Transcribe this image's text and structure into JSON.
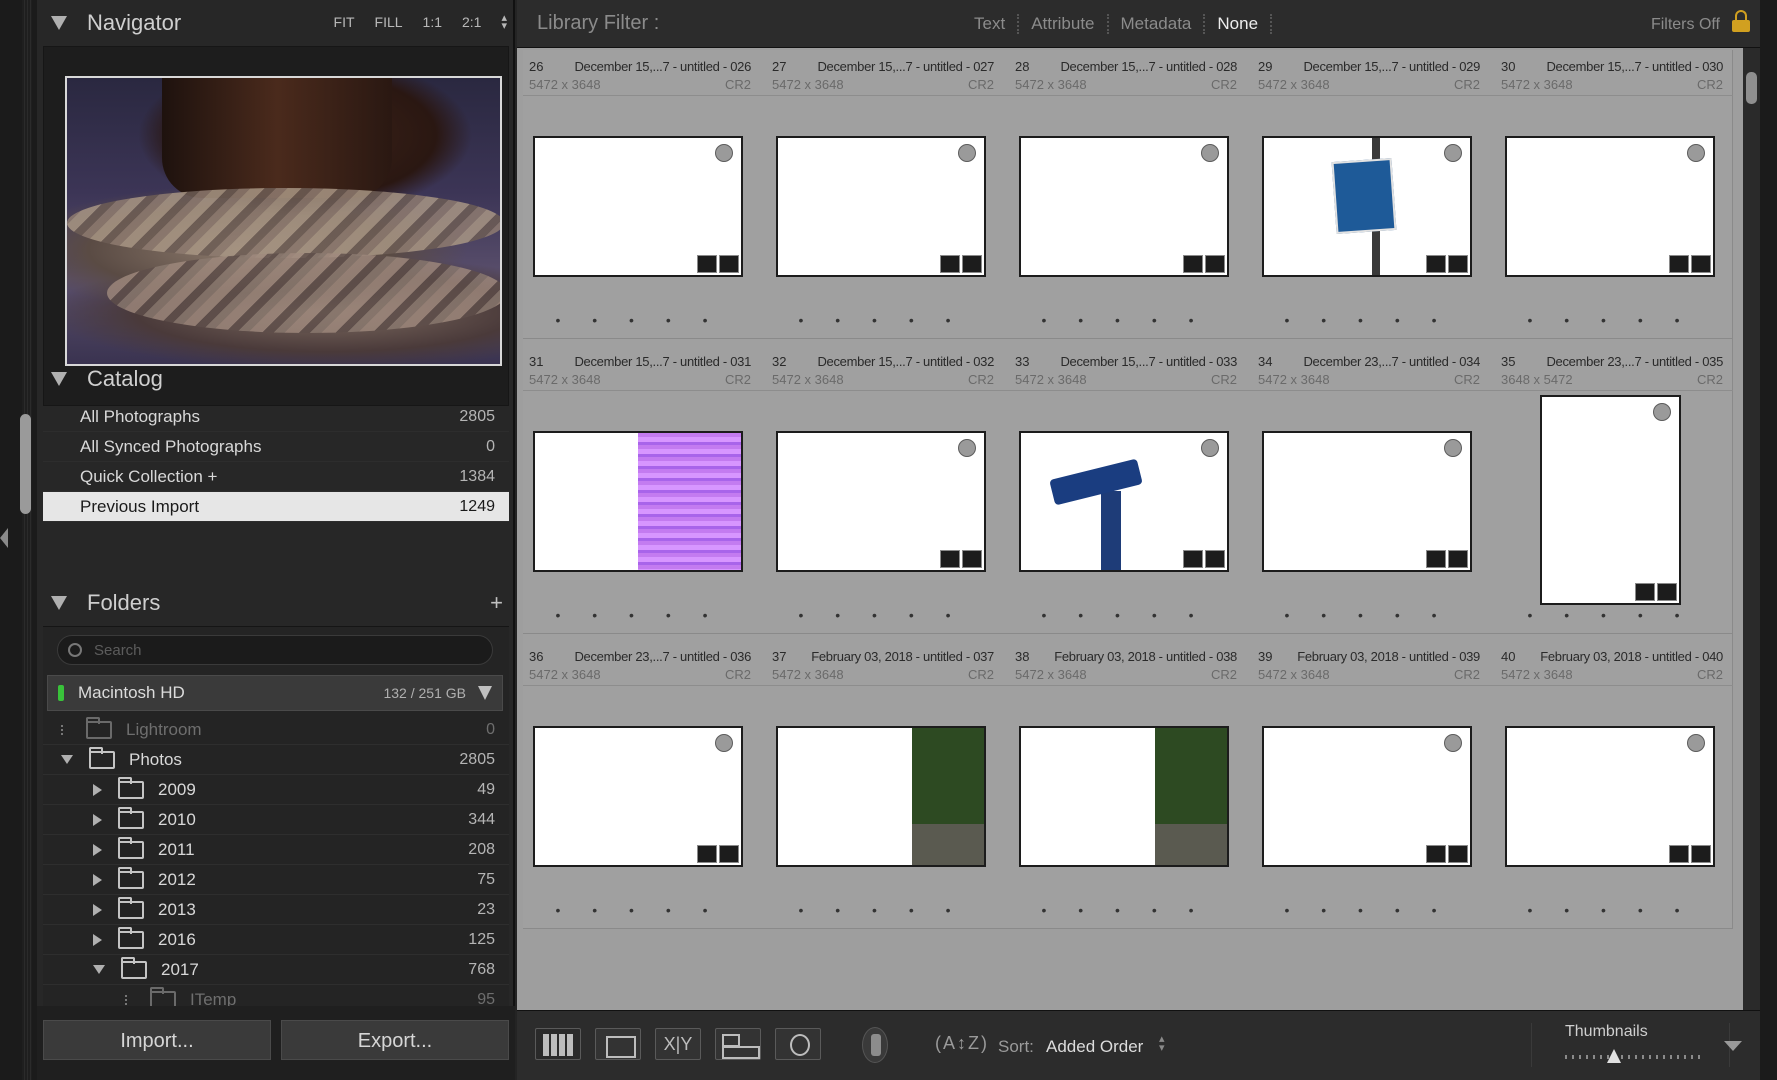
{
  "navigator": {
    "title": "Navigator",
    "zoom_options": [
      "FIT",
      "FILL",
      "1:1",
      "2:1"
    ]
  },
  "catalog": {
    "title": "Catalog",
    "items": [
      {
        "label": "All Photographs",
        "count": "2805"
      },
      {
        "label": "All Synced Photographs",
        "count": "0"
      },
      {
        "label": "Quick Collection +",
        "count": "1384"
      },
      {
        "label": "Previous Import",
        "count": "1249",
        "selected": true
      }
    ]
  },
  "folders": {
    "title": "Folders",
    "add_label": "+",
    "search_placeholder": "Search",
    "volume": {
      "name": "Macintosh HD",
      "usage": "132 / 251 GB"
    },
    "tree": [
      {
        "name": "Lightroom",
        "count": "0",
        "depth": 0,
        "expand": "none",
        "dim": true
      },
      {
        "name": "Photos",
        "count": "2805",
        "depth": 0,
        "expand": "down"
      },
      {
        "name": "2009",
        "count": "49",
        "depth": 1,
        "expand": "right"
      },
      {
        "name": "2010",
        "count": "344",
        "depth": 1,
        "expand": "right"
      },
      {
        "name": "2011",
        "count": "208",
        "depth": 1,
        "expand": "right"
      },
      {
        "name": "2012",
        "count": "75",
        "depth": 1,
        "expand": "right"
      },
      {
        "name": "2013",
        "count": "23",
        "depth": 1,
        "expand": "right"
      },
      {
        "name": "2016",
        "count": "125",
        "depth": 1,
        "expand": "right"
      },
      {
        "name": "2017",
        "count": "768",
        "depth": 1,
        "expand": "down"
      },
      {
        "name": "ITemp",
        "count": "95",
        "depth": 2,
        "expand": "none",
        "dim": true
      }
    ]
  },
  "actions": {
    "import_label": "Import...",
    "export_label": "Export..."
  },
  "library_filter": {
    "label": "Library Filter :",
    "options": [
      "Text",
      "Attribute",
      "Metadata",
      "None"
    ],
    "active": "None",
    "filters_off": "Filters Off"
  },
  "grid": {
    "rating_dots": "• • • • •",
    "cells": [
      {
        "index": "26",
        "name": "December 15,...7 - untitled - 026",
        "dims": "5472 x 3648",
        "ext": "CR2",
        "pattern": "harbor"
      },
      {
        "index": "27",
        "name": "December 15,...7 - untitled - 027",
        "dims": "5472 x 3648",
        "ext": "CR2",
        "pattern": "roof"
      },
      {
        "index": "28",
        "name": "December 15,...7 - untitled - 028",
        "dims": "5472 x 3648",
        "ext": "CR2",
        "pattern": "stripes-yb"
      },
      {
        "index": "29",
        "name": "December 15,...7 - untitled - 029",
        "dims": "5472 x 3648",
        "ext": "CR2",
        "pattern": "sky"
      },
      {
        "index": "30",
        "name": "December 15,...7 - untitled - 030",
        "dims": "5472 x 3648",
        "ext": "CR2",
        "pattern": "glitch-yellow"
      },
      {
        "index": "31",
        "name": "December 15,...7 - untitled - 031",
        "dims": "5472 x 3648",
        "ext": "CR2",
        "pattern": "glitch-pink"
      },
      {
        "index": "32",
        "name": "December 15,...7 - untitled - 032",
        "dims": "5472 x 3648",
        "ext": "CR2",
        "pattern": "stripes-pale"
      },
      {
        "index": "33",
        "name": "December 15,...7 - untitled - 033",
        "dims": "5472 x 3648",
        "ext": "CR2",
        "pattern": "telescope"
      },
      {
        "index": "34",
        "name": "December 23,...7 - untitled - 034",
        "dims": "5472 x 3648",
        "ext": "CR2",
        "pattern": "stripes-pale"
      },
      {
        "index": "35",
        "name": "December 23,...7 - untitled - 035",
        "dims": "3648 x 5472",
        "ext": "CR2",
        "pattern": "stripes-pale",
        "portrait": true
      },
      {
        "index": "36",
        "name": "December 23,...7 - untitled - 036",
        "dims": "5472 x 3648",
        "ext": "CR2",
        "pattern": "stripes-pale"
      },
      {
        "index": "37",
        "name": "February 03, 2018 - untitled - 037",
        "dims": "5472 x 3648",
        "ext": "CR2",
        "pattern": "lake"
      },
      {
        "index": "38",
        "name": "February 03, 2018 - untitled - 038",
        "dims": "5472 x 3648",
        "ext": "CR2",
        "pattern": "lake"
      },
      {
        "index": "39",
        "name": "February 03, 2018 - untitled - 039",
        "dims": "5472 x 3648",
        "ext": "CR2",
        "pattern": "forest"
      },
      {
        "index": "40",
        "name": "February 03, 2018 - untitled - 040",
        "dims": "5472 x 3648",
        "ext": "CR2",
        "pattern": "stripes-pale"
      }
    ]
  },
  "toolbar": {
    "compare_label": "X|Y",
    "sort_icon": "(A↕Z)",
    "sort_label": "Sort:",
    "sort_value": "Added Order",
    "thumbnails_label": "Thumbnails",
    "thumbnail_size": 0.35
  },
  "colors": {
    "grid_bg": "#9e9e9e",
    "panel_bg": "#272727",
    "selected_row": "#e6e6e6",
    "lock": "#d1a020",
    "volume_light": "#39c23a"
  }
}
